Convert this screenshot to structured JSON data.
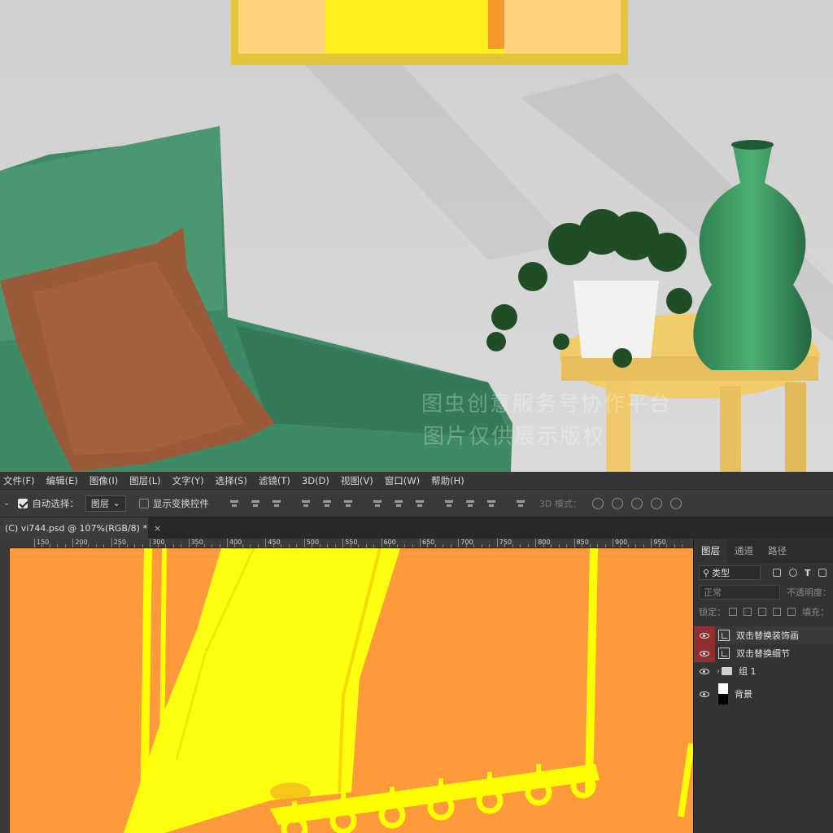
{
  "preview": {
    "watermark_line1": "图虫创意服务号协作平台",
    "watermark_line2": "图片仅供展示版权"
  },
  "menubar": {
    "items": [
      "文件(F)",
      "编辑(E)",
      "图像(I)",
      "图层(L)",
      "文字(Y)",
      "选择(S)",
      "滤镜(T)",
      "3D(D)",
      "视图(V)",
      "窗口(W)",
      "帮助(H)"
    ]
  },
  "options": {
    "auto_select_label": "自动选择：",
    "auto_select_value": "图层",
    "show_transform_label": "显示变换控件",
    "mode3d_label": "3D 模式："
  },
  "document": {
    "tab_title": "(C) vi744.psd @ 107%(RGB/8) *",
    "close": "×"
  },
  "ruler": {
    "labels": [
      "150",
      "200",
      "250",
      "300",
      "350",
      "400",
      "450",
      "500",
      "550",
      "600",
      "650",
      "700",
      "750",
      "800",
      "850",
      "900",
      "950"
    ]
  },
  "layers_panel": {
    "tabs": [
      "图层",
      "通道",
      "路径"
    ],
    "filter_value": "类型",
    "blend_mode": "正常",
    "opacity_label": "不透明度：",
    "lock_label": "锁定：",
    "fill_label": "填充：",
    "layers": [
      {
        "name": "双击替换装饰画",
        "type": "smart",
        "highlight": true
      },
      {
        "name": "双击替换细节",
        "type": "smart",
        "highlight": true
      },
      {
        "name": "组 1",
        "type": "group",
        "highlight": false
      },
      {
        "name": "背景",
        "type": "background",
        "highlight": false
      }
    ]
  },
  "colors": {
    "canvas_bg": "#ff9a3c",
    "canvas_accent": "#ffff00",
    "panel_bg": "#333333",
    "eye_highlight": "#8f2f2f"
  }
}
